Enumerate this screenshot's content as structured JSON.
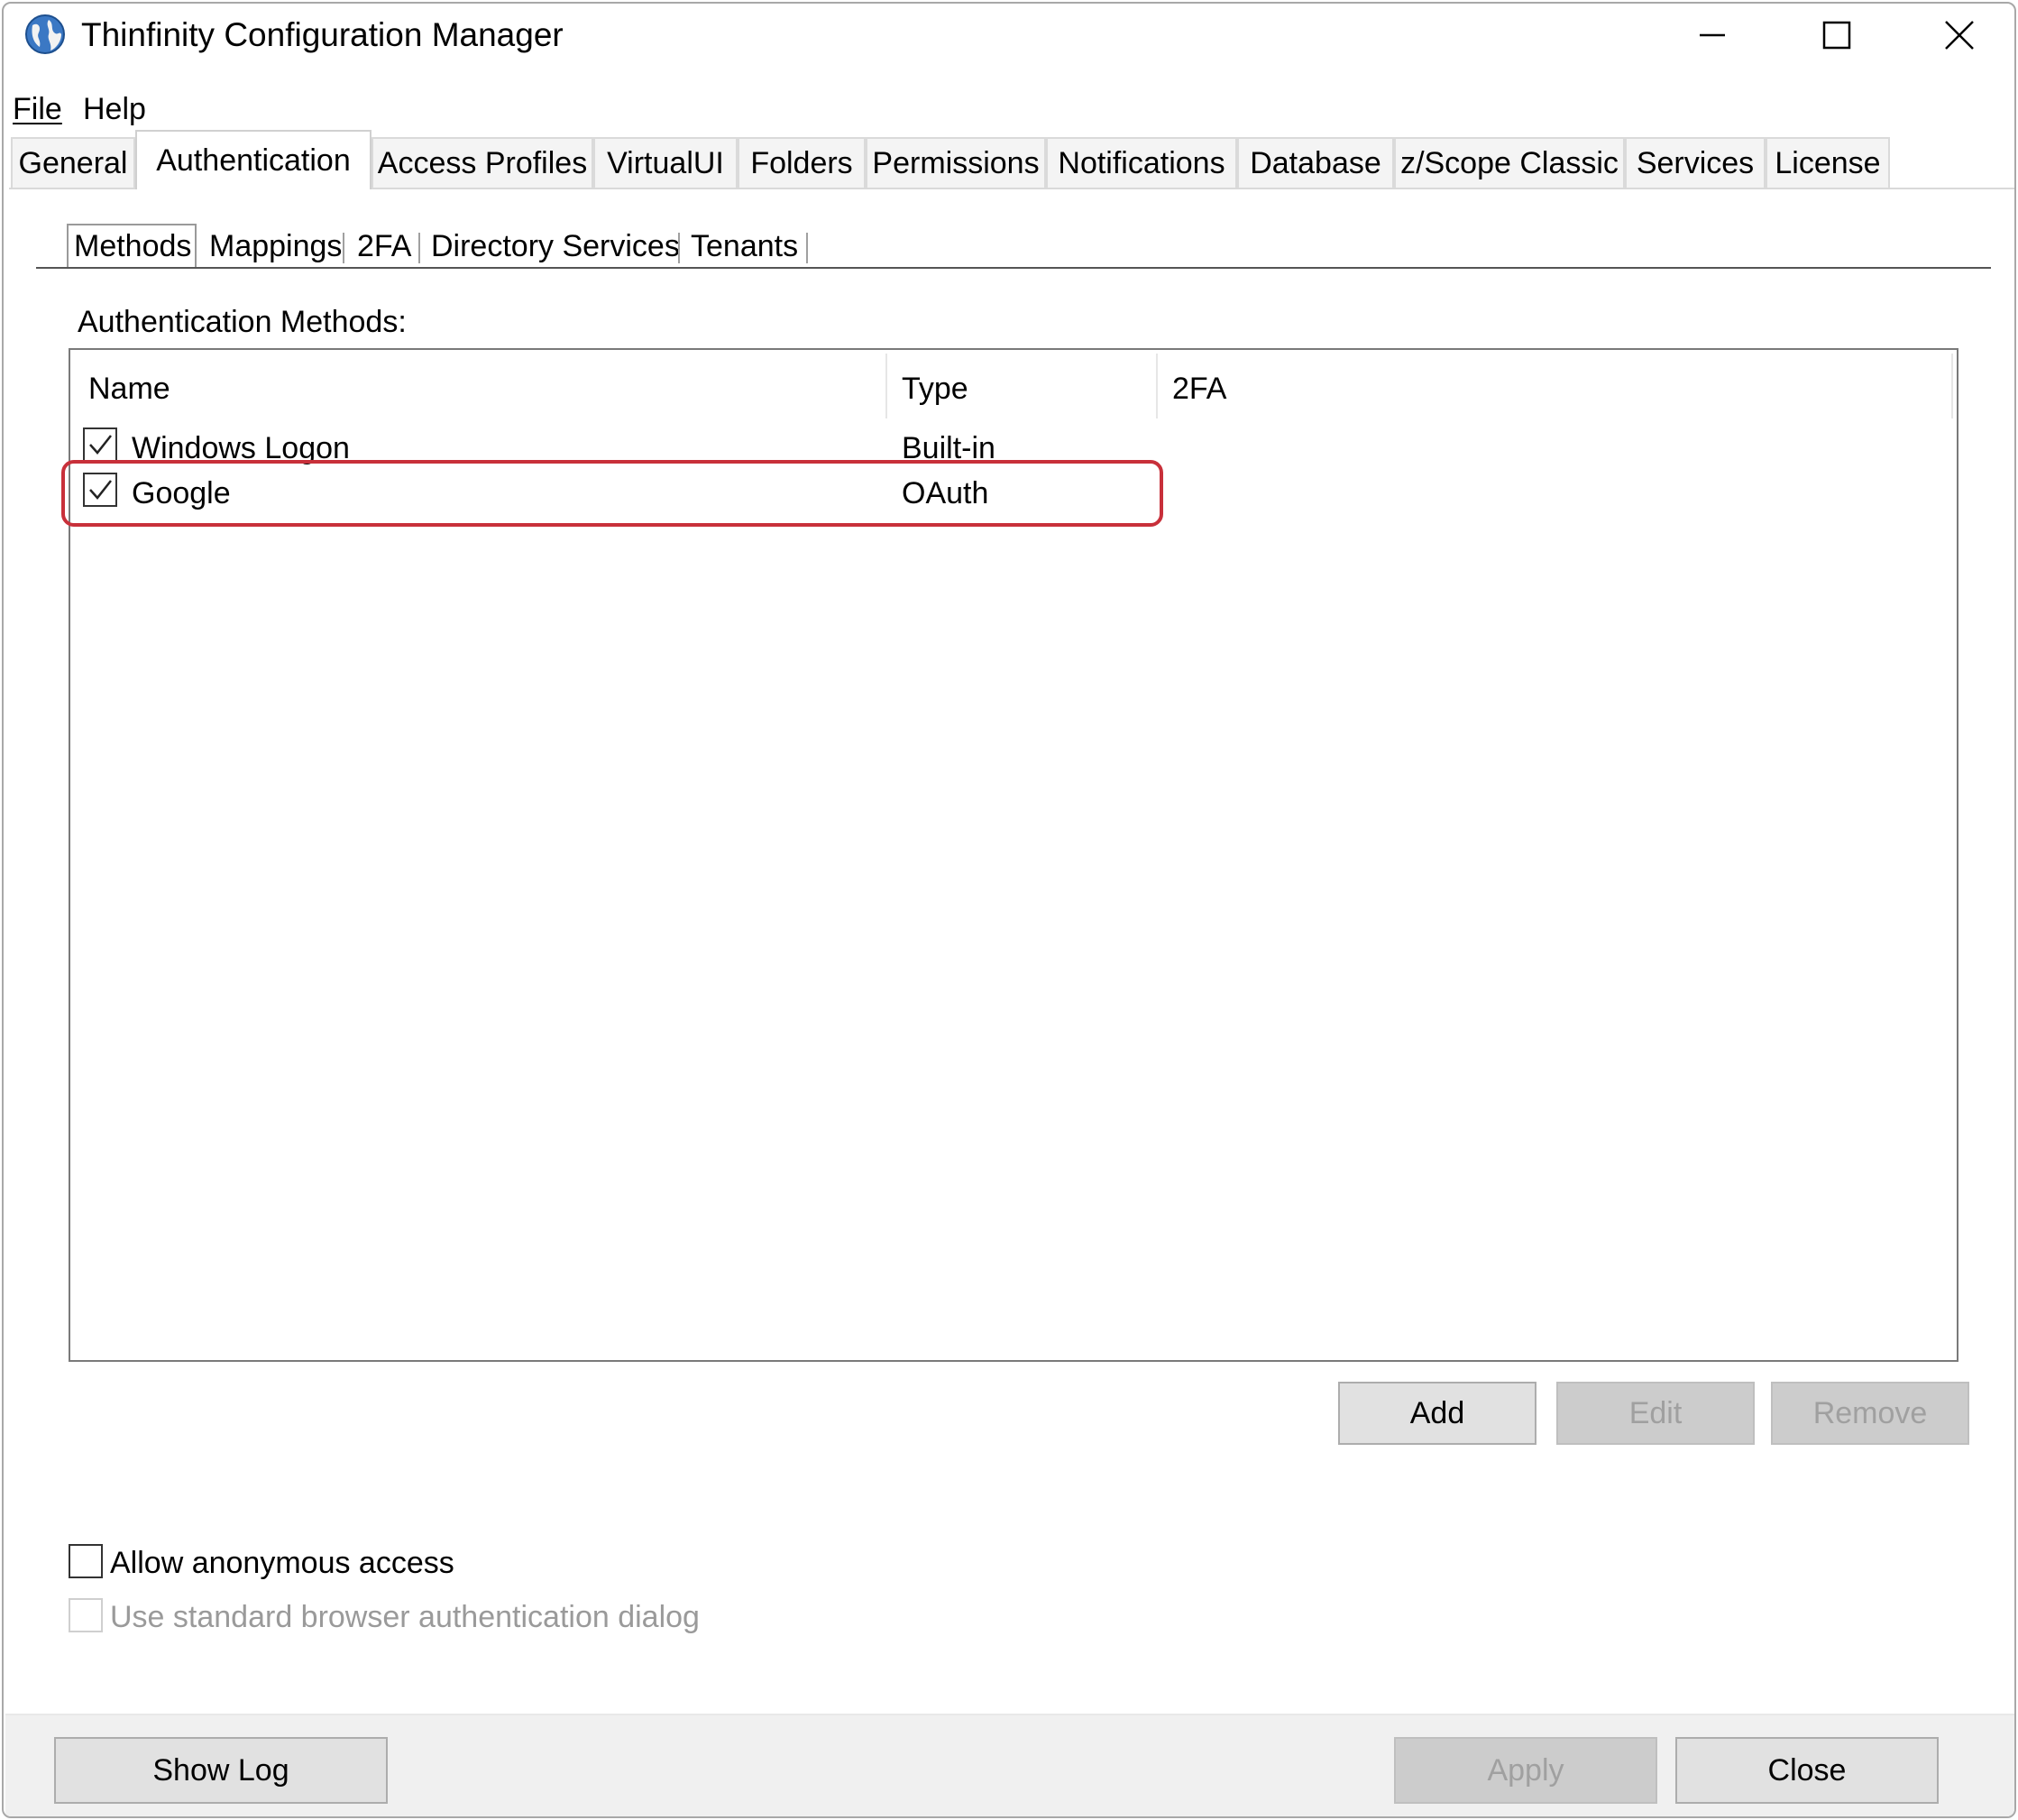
{
  "window": {
    "title": "Thinfinity Configuration Manager",
    "icon": "globe-icon"
  },
  "menu": {
    "file": "File",
    "help": "Help"
  },
  "tabs": [
    {
      "label": "General"
    },
    {
      "label": "Authentication"
    },
    {
      "label": "Access Profiles"
    },
    {
      "label": "VirtualUI"
    },
    {
      "label": "Folders"
    },
    {
      "label": "Permissions"
    },
    {
      "label": "Notifications"
    },
    {
      "label": "Database"
    },
    {
      "label": "z/Scope Classic"
    },
    {
      "label": "Services"
    },
    {
      "label": "License"
    }
  ],
  "active_tab": "Authentication",
  "subtabs": [
    {
      "label": "Methods"
    },
    {
      "label": "Mappings"
    },
    {
      "label": "2FA"
    },
    {
      "label": "Directory Services"
    },
    {
      "label": "Tenants"
    }
  ],
  "active_subtab": "Methods",
  "methods": {
    "section_label": "Authentication Methods:",
    "columns": {
      "name": "Name",
      "type": "Type",
      "twofa": "2FA"
    },
    "rows": [
      {
        "name": "Windows Logon",
        "type": "Built-in",
        "twofa": "",
        "checked": true
      },
      {
        "name": "Google",
        "type": "OAuth",
        "twofa": "",
        "checked": true,
        "highlighted": true
      }
    ],
    "buttons": {
      "add": "Add",
      "edit": "Edit",
      "remove": "Remove"
    }
  },
  "options": {
    "allow_anonymous": {
      "label": "Allow anonymous access",
      "checked": false,
      "enabled": true
    },
    "standard_browser_dialog": {
      "label": "Use standard browser authentication dialog",
      "checked": false,
      "enabled": false
    }
  },
  "footer": {
    "show_log": "Show Log",
    "apply": "Apply",
    "close": "Close"
  },
  "colors": {
    "highlight": "#c8303a",
    "disabled_text": "#a0a0a0"
  }
}
